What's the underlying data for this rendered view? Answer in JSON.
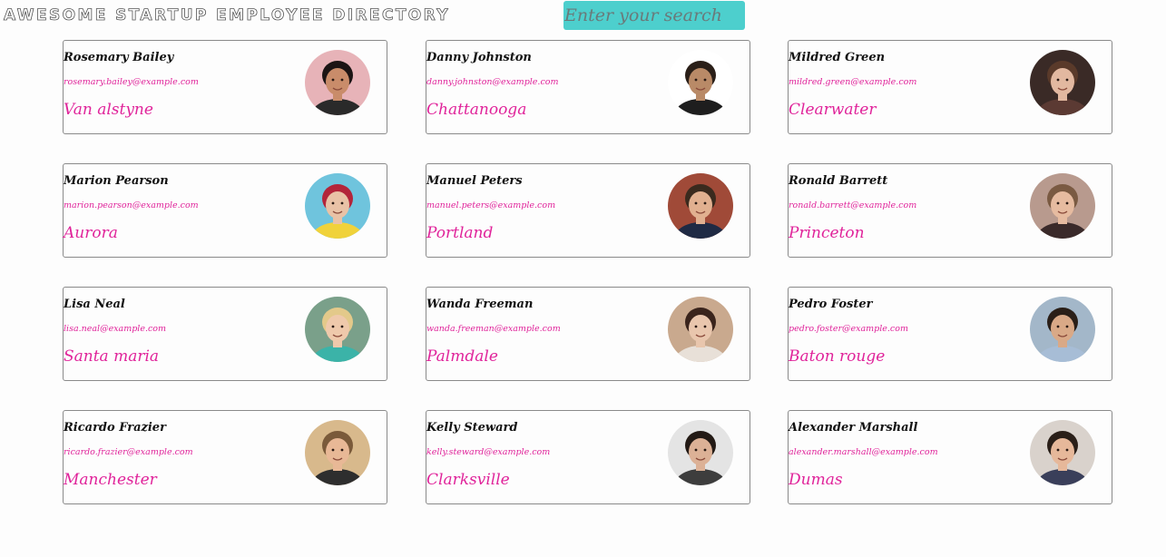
{
  "app": {
    "title": "AWESOME STARTUP EMPLOYEE DIRECTORY"
  },
  "search": {
    "placeholder": "Enter your search",
    "value": ""
  },
  "employees": [
    {
      "name": "Rosemary Bailey",
      "email": "rosemary.bailey@example.com",
      "city": "Van alstyne",
      "avatar": {
        "bg": "#e7b3b8",
        "skin": "#c98c6a",
        "hair": "#1c1414",
        "shirt": "#2a2a2a"
      }
    },
    {
      "name": "Danny Johnston",
      "email": "danny.johnston@example.com",
      "city": "Chattanooga",
      "avatar": {
        "bg": "#ffffff",
        "skin": "#b98a67",
        "hair": "#2a1f18",
        "shirt": "#1e1e1e"
      }
    },
    {
      "name": "Mildred Green",
      "email": "mildred.green@example.com",
      "city": "Clearwater",
      "avatar": {
        "bg": "#3a2a26",
        "skin": "#e2b8a0",
        "hair": "#5a3a2a",
        "shirt": "#5b3a33"
      }
    },
    {
      "name": "Marion Pearson",
      "email": "marion.pearson@example.com",
      "city": "Aurora",
      "avatar": {
        "bg": "#6fc4dd",
        "skin": "#e9c2a6",
        "hair": "#b3253a",
        "shirt": "#f0d23a"
      }
    },
    {
      "name": "Manuel Peters",
      "email": "manuel.peters@example.com",
      "city": "Portland",
      "avatar": {
        "bg": "#a04a38",
        "skin": "#e1b090",
        "hair": "#3a2a1e",
        "shirt": "#1f2a44"
      }
    },
    {
      "name": "Ronald Barrett",
      "email": "ronald.barrett@example.com",
      "city": "Princeton",
      "avatar": {
        "bg": "#b89a8e",
        "skin": "#e6bba0",
        "hair": "#7a5a42",
        "shirt": "#3a2a2a"
      }
    },
    {
      "name": "Lisa Neal",
      "email": "lisa.neal@example.com",
      "city": "Santa maria",
      "avatar": {
        "bg": "#7aa08a",
        "skin": "#efc9ab",
        "hair": "#e3c98a",
        "shirt": "#3bb3a8"
      }
    },
    {
      "name": "Wanda Freeman",
      "email": "wanda.freeman@example.com",
      "city": "Palmdale",
      "avatar": {
        "bg": "#c9a98e",
        "skin": "#e9c6ad",
        "hair": "#3a241c",
        "shirt": "#e8e0d8"
      }
    },
    {
      "name": "Pedro Foster",
      "email": "pedro.foster@example.com",
      "city": "Baton rouge",
      "avatar": {
        "bg": "#a3b7c9",
        "skin": "#d9a987",
        "hair": "#2a1f18",
        "shirt": "#a7bdd6"
      }
    },
    {
      "name": "Ricardo Frazier",
      "email": "ricardo.frazier@example.com",
      "city": "Manchester",
      "avatar": {
        "bg": "#d8b98c",
        "skin": "#e8b896",
        "hair": "#7a5a3a",
        "shirt": "#2e2e2e"
      }
    },
    {
      "name": "Kelly Steward",
      "email": "kelly.steward@example.com",
      "city": "Clarksville",
      "avatar": {
        "bg": "#e4e4e4",
        "skin": "#dcb196",
        "hair": "#231a15",
        "shirt": "#3d3d3d"
      }
    },
    {
      "name": "Alexander Marshall",
      "email": "alexander.marshall@example.com",
      "city": "Dumas",
      "avatar": {
        "bg": "#d9d2cc",
        "skin": "#e6b89a",
        "hair": "#2a1f18",
        "shirt": "#3a3f5a"
      }
    }
  ]
}
